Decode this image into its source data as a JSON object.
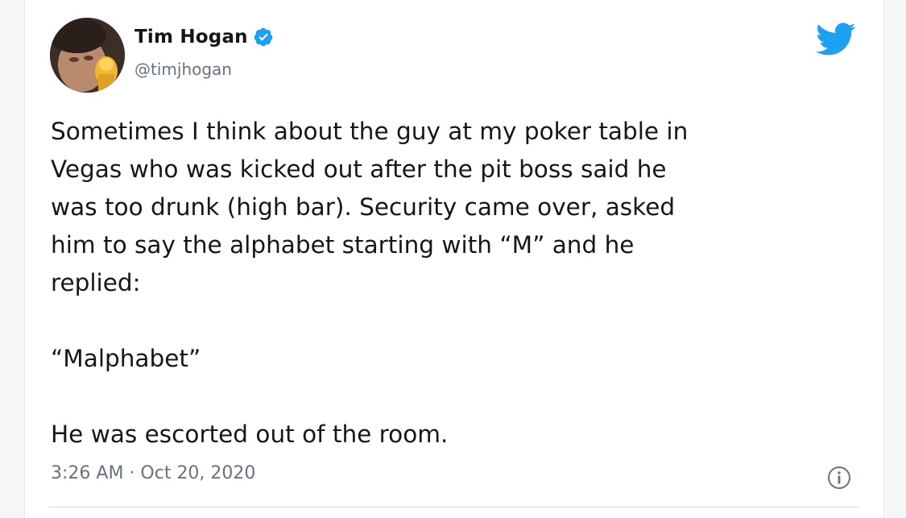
{
  "author": {
    "display_name": "Tim Hogan",
    "handle": "@timjhogan",
    "verified": true,
    "avatar_icon": "profile-photo",
    "verified_icon": "verified-badge-icon"
  },
  "brand": {
    "icon": "twitter-bird-icon",
    "color": "#1da1f2"
  },
  "tweet": {
    "lines": [
      "Sometimes I think about the guy at my poker table in",
      "Vegas who was kicked out after the pit boss said he",
      "was too drunk (high bar). Security came over, asked",
      "him to say the alphabet starting with “M” and he",
      "replied:"
    ],
    "quote": "“Malphabet”",
    "closing": "He was escorted out of the room."
  },
  "meta": {
    "timestamp": "3:26 AM · Oct 20, 2020",
    "info_icon": "info-icon"
  }
}
